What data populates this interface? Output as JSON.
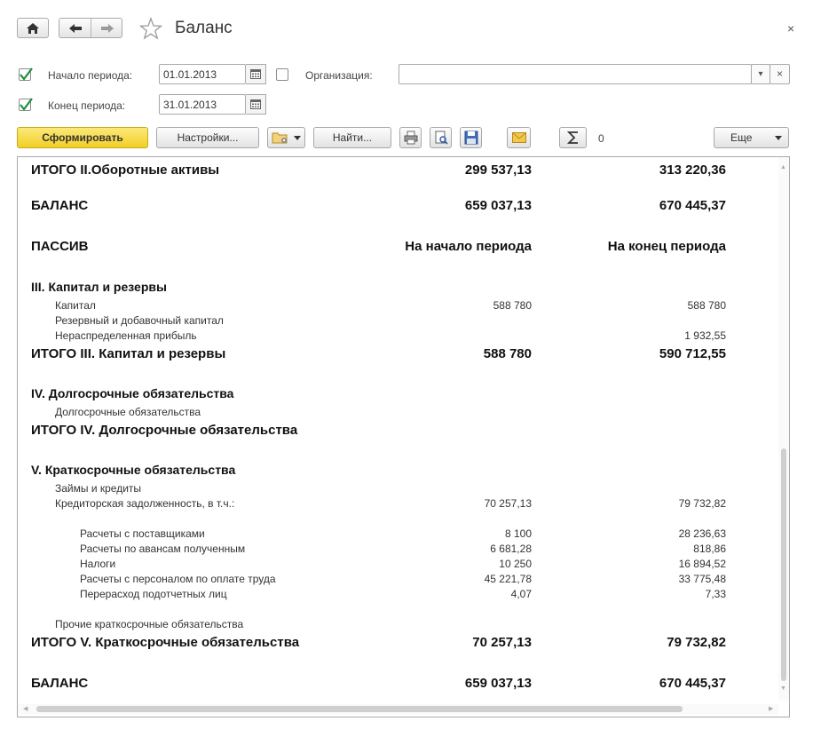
{
  "window": {
    "title": "Баланс",
    "close_label": "×"
  },
  "filters": {
    "start_label": "Начало периода:",
    "start_value": "01.01.2013",
    "start_checked": true,
    "end_label": "Конец периода:",
    "end_value": "31.01.2013",
    "end_checked": true,
    "org_label": "Организация:",
    "org_checked": false,
    "org_value": "",
    "org_dropdown": "▾",
    "org_clear": "×"
  },
  "toolbar": {
    "generate_label": "Сформировать",
    "settings_label": "Настройки...",
    "find_label": "Найти...",
    "sum_value": "0",
    "more_label": "Еще"
  },
  "report": {
    "rows": [
      {
        "name": "ИТОГО II.Оборотные активы",
        "v1": "299 537,13",
        "v2": "313 220,36"
      },
      {
        "name": "БАЛАНС",
        "v1": "659 037,13",
        "v2": "670 445,37"
      },
      {
        "name": "ПАССИВ",
        "v1": "На начало периода",
        "v2": "На конец периода"
      },
      {
        "name": "III. Капитал и резервы",
        "v1": "",
        "v2": ""
      },
      {
        "name": "Капитал",
        "v1": "588 780",
        "v2": "588 780"
      },
      {
        "name": "Резервный и добавочный капитал",
        "v1": "",
        "v2": ""
      },
      {
        "name": "Нераспределенная прибыль",
        "v1": "",
        "v2": "1 932,55"
      },
      {
        "name": "ИТОГО III. Капитал и резервы",
        "v1": "588 780",
        "v2": "590 712,55"
      },
      {
        "name": "IV. Долгосрочные обязательства",
        "v1": "",
        "v2": ""
      },
      {
        "name": "Долгосрочные обязательства",
        "v1": "",
        "v2": ""
      },
      {
        "name": "ИТОГО IV. Долгосрочные обязательства",
        "v1": "",
        "v2": ""
      },
      {
        "name": "V. Краткосрочные обязательства",
        "v1": "",
        "v2": ""
      },
      {
        "name": "Займы и кредиты",
        "v1": "",
        "v2": ""
      },
      {
        "name": "Кредиторская задолженность, в т.ч.:",
        "v1": "70 257,13",
        "v2": "79 732,82"
      },
      {
        "name": "Расчеты с поставщиками",
        "v1": "8 100",
        "v2": "28 236,63"
      },
      {
        "name": "Расчеты по авансам полученным",
        "v1": "6 681,28",
        "v2": "818,86"
      },
      {
        "name": "Налоги",
        "v1": "10 250",
        "v2": "16 894,52"
      },
      {
        "name": "Расчеты с персоналом по оплате труда",
        "v1": "45 221,78",
        "v2": "33 775,48"
      },
      {
        "name": "Перерасход подотчетных лиц",
        "v1": "4,07",
        "v2": "7,33"
      },
      {
        "name": "Прочие краткосрочные обязательства",
        "v1": "",
        "v2": ""
      },
      {
        "name": "ИТОГО V. Краткосрочные обязательства",
        "v1": "70 257,13",
        "v2": "79 732,82"
      },
      {
        "name": "БАЛАНС",
        "v1": "659 037,13",
        "v2": "670 445,37"
      }
    ]
  }
}
